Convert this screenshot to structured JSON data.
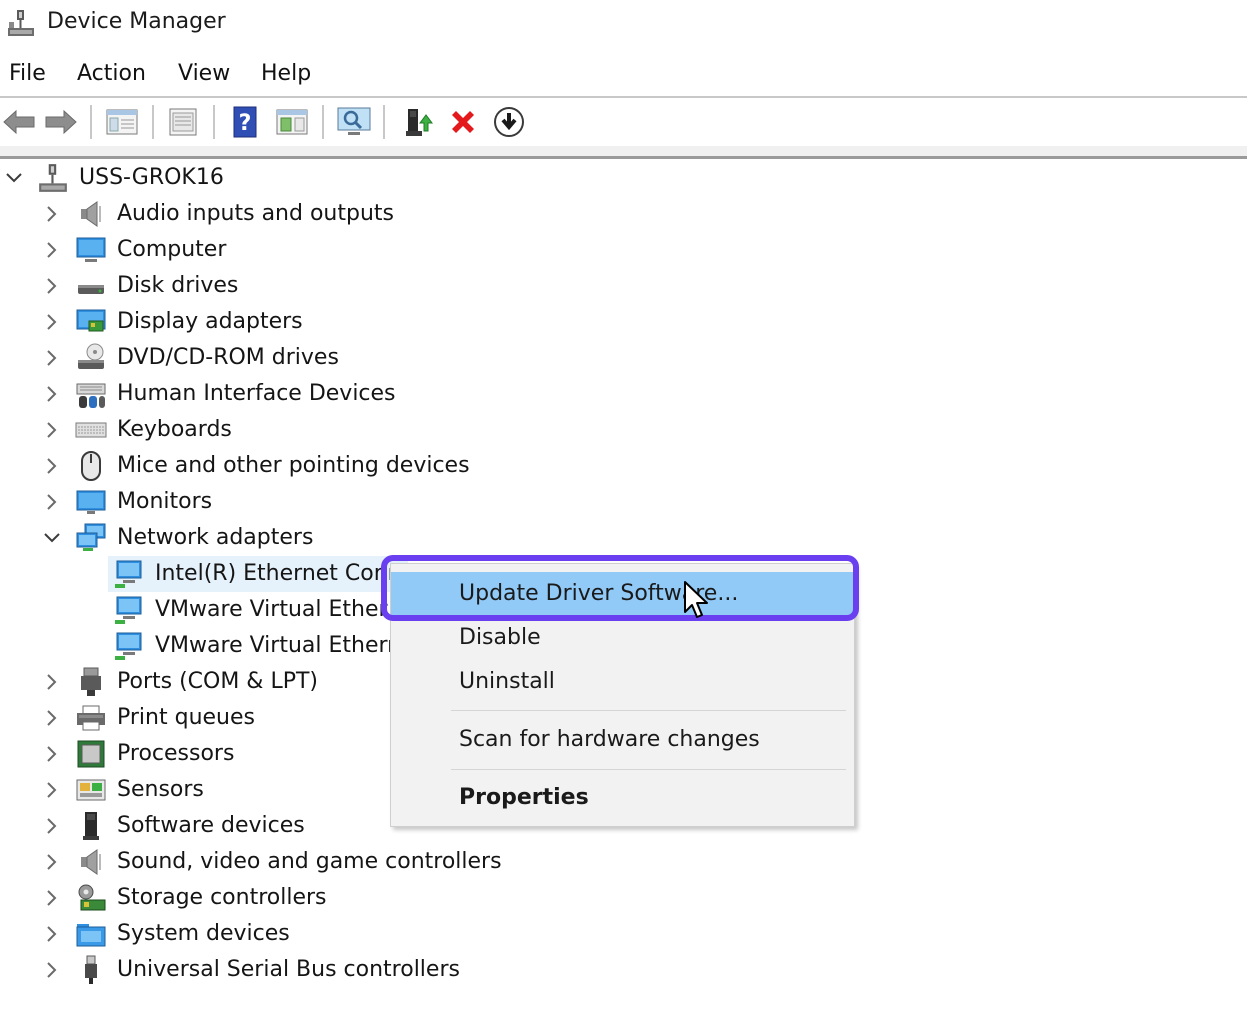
{
  "window": {
    "title": "Device Manager"
  },
  "menubar": {
    "items": [
      "File",
      "Action",
      "View",
      "Help"
    ]
  },
  "tree": {
    "root": "USS-GROK16",
    "categories": [
      {
        "label": "Audio inputs and outputs",
        "icon": "speaker-icon"
      },
      {
        "label": "Computer",
        "icon": "computer-icon"
      },
      {
        "label": "Disk drives",
        "icon": "disk-drive-icon"
      },
      {
        "label": "Display adapters",
        "icon": "display-adapter-icon"
      },
      {
        "label": "DVD/CD-ROM drives",
        "icon": "dvd-drive-icon"
      },
      {
        "label": "Human Interface Devices",
        "icon": "hid-icon"
      },
      {
        "label": "Keyboards",
        "icon": "keyboard-icon"
      },
      {
        "label": "Mice and other pointing devices",
        "icon": "mouse-icon"
      },
      {
        "label": "Monitors",
        "icon": "monitor-icon"
      },
      {
        "label": "Network adapters",
        "icon": "network-icon",
        "expanded": true
      },
      {
        "label": "Ports (COM & LPT)",
        "icon": "port-icon"
      },
      {
        "label": "Print queues",
        "icon": "printer-icon"
      },
      {
        "label": "Processors",
        "icon": "processor-icon"
      },
      {
        "label": "Sensors",
        "icon": "sensor-icon"
      },
      {
        "label": "Software devices",
        "icon": "software-device-icon"
      },
      {
        "label": "Sound, video and game controllers",
        "icon": "speaker-icon"
      },
      {
        "label": "Storage controllers",
        "icon": "storage-controller-icon"
      },
      {
        "label": "System devices",
        "icon": "system-folder-icon"
      },
      {
        "label": "Universal Serial Bus controllers",
        "icon": "usb-icon"
      }
    ],
    "network_children": [
      "Intel(R) Ethernet Conn",
      "VMware Virtual Ether",
      "VMware Virtual Ethern"
    ]
  },
  "context_menu": {
    "items": [
      "Update Driver Software...",
      "Disable",
      "Uninstall",
      "Scan for hardware changes",
      "Properties"
    ]
  },
  "colors": {
    "menu_highlight": "#91c9f7",
    "annotation_box": "#6a3ff0",
    "selected_row": "#e5f1fb"
  }
}
